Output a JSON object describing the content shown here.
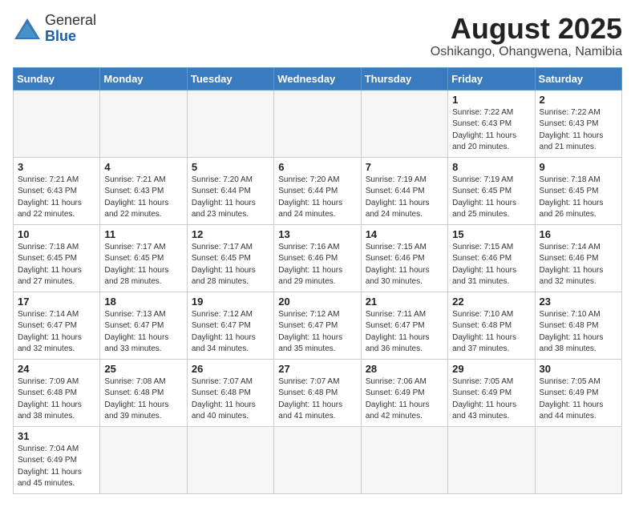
{
  "header": {
    "logo_general": "General",
    "logo_blue": "Blue",
    "month_year": "August 2025",
    "location": "Oshikango, Ohangwena, Namibia"
  },
  "weekdays": [
    "Sunday",
    "Monday",
    "Tuesday",
    "Wednesday",
    "Thursday",
    "Friday",
    "Saturday"
  ],
  "weeks": [
    [
      {
        "day": "",
        "info": ""
      },
      {
        "day": "",
        "info": ""
      },
      {
        "day": "",
        "info": ""
      },
      {
        "day": "",
        "info": ""
      },
      {
        "day": "",
        "info": ""
      },
      {
        "day": "1",
        "info": "Sunrise: 7:22 AM\nSunset: 6:43 PM\nDaylight: 11 hours\nand 20 minutes."
      },
      {
        "day": "2",
        "info": "Sunrise: 7:22 AM\nSunset: 6:43 PM\nDaylight: 11 hours\nand 21 minutes."
      }
    ],
    [
      {
        "day": "3",
        "info": "Sunrise: 7:21 AM\nSunset: 6:43 PM\nDaylight: 11 hours\nand 22 minutes."
      },
      {
        "day": "4",
        "info": "Sunrise: 7:21 AM\nSunset: 6:43 PM\nDaylight: 11 hours\nand 22 minutes."
      },
      {
        "day": "5",
        "info": "Sunrise: 7:20 AM\nSunset: 6:44 PM\nDaylight: 11 hours\nand 23 minutes."
      },
      {
        "day": "6",
        "info": "Sunrise: 7:20 AM\nSunset: 6:44 PM\nDaylight: 11 hours\nand 24 minutes."
      },
      {
        "day": "7",
        "info": "Sunrise: 7:19 AM\nSunset: 6:44 PM\nDaylight: 11 hours\nand 24 minutes."
      },
      {
        "day": "8",
        "info": "Sunrise: 7:19 AM\nSunset: 6:45 PM\nDaylight: 11 hours\nand 25 minutes."
      },
      {
        "day": "9",
        "info": "Sunrise: 7:18 AM\nSunset: 6:45 PM\nDaylight: 11 hours\nand 26 minutes."
      }
    ],
    [
      {
        "day": "10",
        "info": "Sunrise: 7:18 AM\nSunset: 6:45 PM\nDaylight: 11 hours\nand 27 minutes."
      },
      {
        "day": "11",
        "info": "Sunrise: 7:17 AM\nSunset: 6:45 PM\nDaylight: 11 hours\nand 28 minutes."
      },
      {
        "day": "12",
        "info": "Sunrise: 7:17 AM\nSunset: 6:45 PM\nDaylight: 11 hours\nand 28 minutes."
      },
      {
        "day": "13",
        "info": "Sunrise: 7:16 AM\nSunset: 6:46 PM\nDaylight: 11 hours\nand 29 minutes."
      },
      {
        "day": "14",
        "info": "Sunrise: 7:15 AM\nSunset: 6:46 PM\nDaylight: 11 hours\nand 30 minutes."
      },
      {
        "day": "15",
        "info": "Sunrise: 7:15 AM\nSunset: 6:46 PM\nDaylight: 11 hours\nand 31 minutes."
      },
      {
        "day": "16",
        "info": "Sunrise: 7:14 AM\nSunset: 6:46 PM\nDaylight: 11 hours\nand 32 minutes."
      }
    ],
    [
      {
        "day": "17",
        "info": "Sunrise: 7:14 AM\nSunset: 6:47 PM\nDaylight: 11 hours\nand 32 minutes."
      },
      {
        "day": "18",
        "info": "Sunrise: 7:13 AM\nSunset: 6:47 PM\nDaylight: 11 hours\nand 33 minutes."
      },
      {
        "day": "19",
        "info": "Sunrise: 7:12 AM\nSunset: 6:47 PM\nDaylight: 11 hours\nand 34 minutes."
      },
      {
        "day": "20",
        "info": "Sunrise: 7:12 AM\nSunset: 6:47 PM\nDaylight: 11 hours\nand 35 minutes."
      },
      {
        "day": "21",
        "info": "Sunrise: 7:11 AM\nSunset: 6:47 PM\nDaylight: 11 hours\nand 36 minutes."
      },
      {
        "day": "22",
        "info": "Sunrise: 7:10 AM\nSunset: 6:48 PM\nDaylight: 11 hours\nand 37 minutes."
      },
      {
        "day": "23",
        "info": "Sunrise: 7:10 AM\nSunset: 6:48 PM\nDaylight: 11 hours\nand 38 minutes."
      }
    ],
    [
      {
        "day": "24",
        "info": "Sunrise: 7:09 AM\nSunset: 6:48 PM\nDaylight: 11 hours\nand 38 minutes."
      },
      {
        "day": "25",
        "info": "Sunrise: 7:08 AM\nSunset: 6:48 PM\nDaylight: 11 hours\nand 39 minutes."
      },
      {
        "day": "26",
        "info": "Sunrise: 7:07 AM\nSunset: 6:48 PM\nDaylight: 11 hours\nand 40 minutes."
      },
      {
        "day": "27",
        "info": "Sunrise: 7:07 AM\nSunset: 6:48 PM\nDaylight: 11 hours\nand 41 minutes."
      },
      {
        "day": "28",
        "info": "Sunrise: 7:06 AM\nSunset: 6:49 PM\nDaylight: 11 hours\nand 42 minutes."
      },
      {
        "day": "29",
        "info": "Sunrise: 7:05 AM\nSunset: 6:49 PM\nDaylight: 11 hours\nand 43 minutes."
      },
      {
        "day": "30",
        "info": "Sunrise: 7:05 AM\nSunset: 6:49 PM\nDaylight: 11 hours\nand 44 minutes."
      }
    ],
    [
      {
        "day": "31",
        "info": "Sunrise: 7:04 AM\nSunset: 6:49 PM\nDaylight: 11 hours\nand 45 minutes."
      },
      {
        "day": "",
        "info": ""
      },
      {
        "day": "",
        "info": ""
      },
      {
        "day": "",
        "info": ""
      },
      {
        "day": "",
        "info": ""
      },
      {
        "day": "",
        "info": ""
      },
      {
        "day": "",
        "info": ""
      }
    ]
  ]
}
